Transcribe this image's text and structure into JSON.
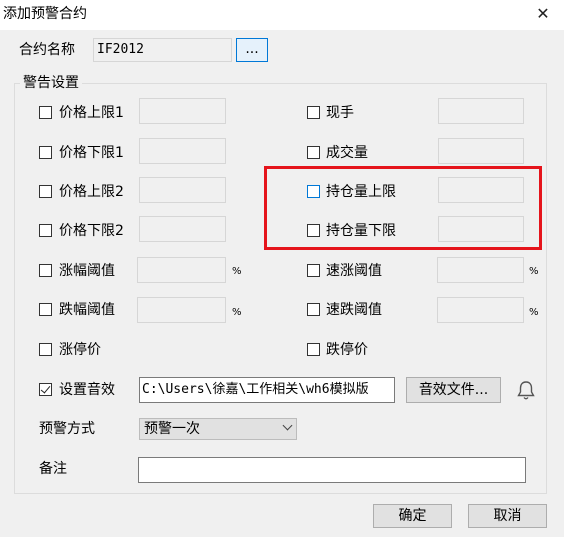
{
  "window": {
    "title": "添加预警合约",
    "close_glyph": "✕"
  },
  "contract": {
    "label": "合约名称",
    "value": "IF2012",
    "browse_label": "..."
  },
  "warning_group": {
    "title": "警告设置",
    "left_items": [
      {
        "label": "价格上限1",
        "checked": false
      },
      {
        "label": "价格下限1",
        "checked": false
      },
      {
        "label": "价格上限2",
        "checked": false
      },
      {
        "label": "价格下限2",
        "checked": false
      },
      {
        "label": "涨幅阈值",
        "checked": false,
        "unit": "%"
      },
      {
        "label": "跌幅阈值",
        "checked": false,
        "unit": "%"
      },
      {
        "label": "涨停价",
        "checked": false
      }
    ],
    "right_items": [
      {
        "label": "现手",
        "checked": false
      },
      {
        "label": "成交量",
        "checked": false
      },
      {
        "label": "持仓量上限",
        "checked": false
      },
      {
        "label": "持仓量下限",
        "checked": false
      },
      {
        "label": "速涨阈值",
        "checked": false,
        "unit": "%"
      },
      {
        "label": "速跌阈值",
        "checked": false,
        "unit": "%"
      },
      {
        "label": "跌停价",
        "checked": false
      }
    ],
    "sound": {
      "label": "设置音效",
      "checked": true,
      "path": "C:\\Users\\徐嘉\\工作相关\\wh6模拟版",
      "file_button": "音效文件...",
      "icon": "bell-icon"
    },
    "method": {
      "label": "预警方式",
      "selected": "预警一次"
    },
    "note": {
      "label": "备注",
      "value": ""
    }
  },
  "buttons": {
    "ok": "确定",
    "cancel": "取消"
  },
  "colors": {
    "highlight": "#e5141b",
    "focus": "#0078d7"
  }
}
